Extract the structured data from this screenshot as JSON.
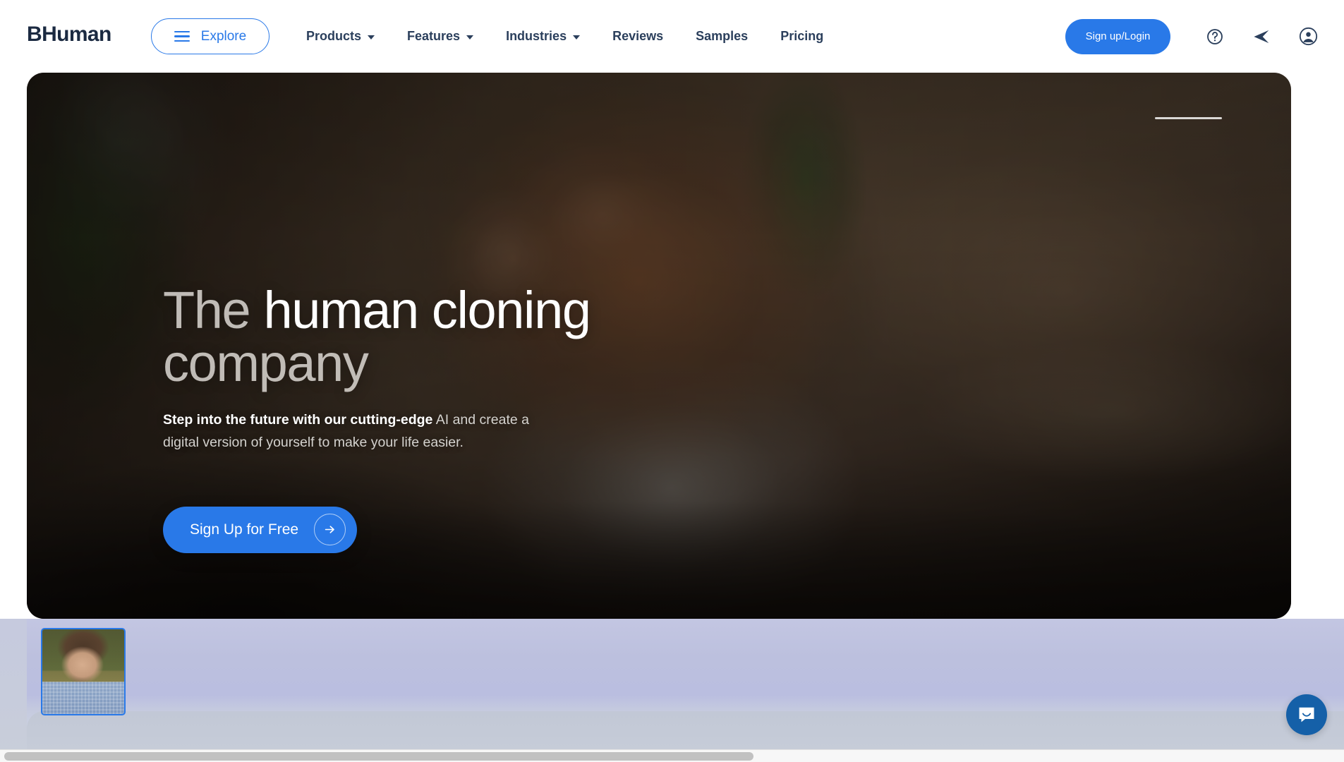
{
  "brand": {
    "name": "BHuman"
  },
  "header": {
    "explore": {
      "label": "Explore",
      "icon": "hamburger-icon"
    },
    "nav": [
      {
        "label": "Products",
        "has_caret": true
      },
      {
        "label": "Features",
        "has_caret": true
      },
      {
        "label": "Industries",
        "has_caret": true
      },
      {
        "label": "Reviews",
        "has_caret": false
      },
      {
        "label": "Samples",
        "has_caret": false
      },
      {
        "label": "Pricing",
        "has_caret": false
      }
    ],
    "signup_label": "Sign up/Login",
    "icons": [
      {
        "name": "help-circle-icon"
      },
      {
        "name": "send-icon"
      },
      {
        "name": "account-circle-icon"
      }
    ]
  },
  "hero": {
    "title_part_1": "The ",
    "title_part_2": "human cloning",
    "title_part_3": "company",
    "sub_strong": "Step into the future with our cutting-edge",
    "sub_rest": " AI and create a digital version of yourself to make your life easier.",
    "cta_label": "Sign Up for Free",
    "cta_icon": "arrow-right-icon",
    "slider": "hero-progress-slider"
  },
  "below": {
    "thumbnail_alt": "user-avatar-thumbnail"
  },
  "widgets": {
    "chat_icon": "intercom-chat-icon"
  },
  "colors": {
    "accent_blue": "#2979e8",
    "brand_navy": "#1b2a41",
    "nav_text": "#2b3f5c",
    "chat_blue": "#1560a8",
    "below_lavender": "#bcc0de"
  }
}
